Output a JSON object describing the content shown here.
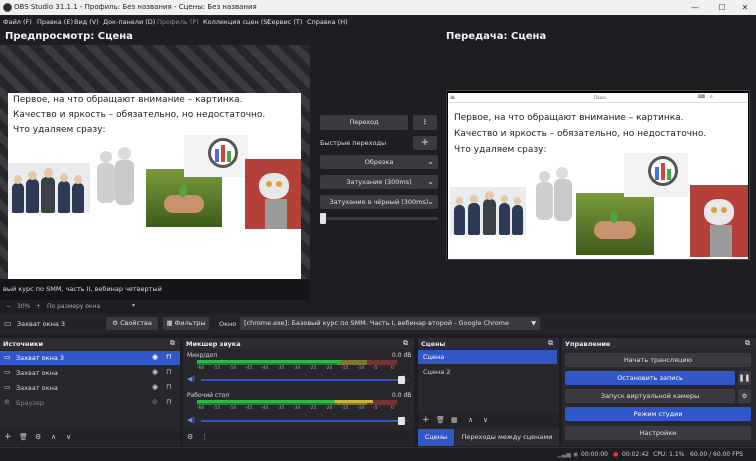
{
  "window": {
    "title": "OBS Studio 31.1.1 - Профиль: Без названия - Сцены: Без названия",
    "minimize": "—",
    "maximize": "☐",
    "close": "✕"
  },
  "menu": [
    "Файл (F)",
    "Правка (E)",
    "Вид (V)",
    "Док-панели (D)",
    "Профиль (P)",
    "Коллекция сцен (S)",
    "Сервис (T)",
    "Справка (H)"
  ],
  "preview": {
    "title": "Предпросмотр: Сцена",
    "zoom": "30%",
    "zoom_mode": "По размеру окна",
    "caption": "вый курс по SMM, часть II, вебинар четвертый"
  },
  "program": {
    "title": "Передача: Сцена",
    "topbar_text": "Поиск"
  },
  "slide": {
    "lines": [
      "Первое, на что обращают внимание – картинка.",
      "Качество и яркость – обязательно, но недостаточно.",
      "Что удаляем сразу:"
    ]
  },
  "transitions": {
    "transition_button": "Переход",
    "quick_label": "Быстрые переходы",
    "items": [
      "Обрезка",
      "Затухание (300ms)",
      "Затухание в чёрный (300ms)"
    ],
    "slider_value": 0
  },
  "source_bar": {
    "name": "Захват окна 3",
    "properties": "Свойства",
    "filters": "Фильтры",
    "window_label": "Окно",
    "window_value": "[chrome.exe]: Базовый курс по SMM. Часть I, вебинар второй - Google Chrome"
  },
  "sources": {
    "title": "Источники",
    "items": [
      {
        "label": "Захват окна 3",
        "selected": true,
        "visible": true,
        "locked": false
      },
      {
        "label": "Захват окна",
        "selected": false,
        "visible": true,
        "locked": false
      },
      {
        "label": "Захват окна",
        "selected": false,
        "visible": true,
        "locked": false
      },
      {
        "label": "Браузер",
        "selected": false,
        "visible": false,
        "locked": false
      }
    ]
  },
  "mixer": {
    "title": "Микшер звука",
    "channels": [
      {
        "name": "Микр/доп",
        "db": "0.0 dB",
        "volume": 0.98
      },
      {
        "name": "Рабочий стол",
        "db": "0.0 dB",
        "volume": 0.98
      }
    ],
    "ticks": [
      "-60",
      "-55",
      "-50",
      "-45",
      "-40",
      "-35",
      "-30",
      "-25",
      "-20",
      "-15",
      "-10",
      "-5",
      "0"
    ]
  },
  "scenes": {
    "title": "Сцены",
    "items": [
      {
        "label": "Сцена",
        "selected": true
      },
      {
        "label": "Сцена 2",
        "selected": false
      }
    ],
    "tab_scenes": "Сцены",
    "tab_transitions": "Переходы между сценами"
  },
  "controls": {
    "title": "Управление",
    "start_stream": "Начать трансляцию",
    "stop_record": "Остановить запись",
    "virtual_cam": "Запуск виртуальной камеры",
    "studio_mode": "Режим студии",
    "settings": "Настройки"
  },
  "status": {
    "stream_time": "00:00:00",
    "rec_time": "00:02:42",
    "cpu": "CPU: 1.1%",
    "fps": "60.00 / 60.00 FPS"
  },
  "colors": {
    "accent": "#2f57c9",
    "bg": "#1e1e22",
    "dock": "#27272c",
    "meter_green": "#2db84a",
    "meter_yellow": "#c8b43a",
    "meter_red": "#b23a3a",
    "rec": "#e53935"
  }
}
